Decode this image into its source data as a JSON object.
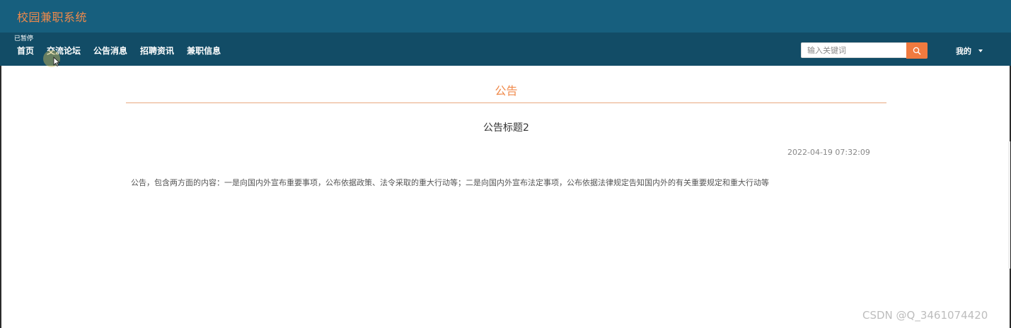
{
  "header": {
    "site_title": "校园兼职系统",
    "paused_label": "已暂停"
  },
  "nav": {
    "items": [
      {
        "label": "首页"
      },
      {
        "label": "交流论坛"
      },
      {
        "label": "公告消息"
      },
      {
        "label": "招聘资讯"
      },
      {
        "label": "兼职信息"
      }
    ]
  },
  "search": {
    "placeholder": "输入关键词",
    "icon": "search-icon",
    "button_color": "#f07a3f"
  },
  "user_menu": {
    "label": "我的",
    "icon": "caret-down-icon"
  },
  "content": {
    "section_heading": "公告",
    "title": "公告标题2",
    "date": "2022-04-19 07:32:09",
    "body": "公告，包含两方面的内容：一是向国内外宣布重要事项，公布依据政策、法令采取的重大行动等；二是向国内外宣布法定事项，公布依据法律规定告知国内外的有关重要规定和重大行动等"
  },
  "watermark": "CSDN @Q_3461074420",
  "colors": {
    "header_bg": "#175f7e",
    "nav_bg": "#124c66",
    "accent": "#f08a4b"
  }
}
